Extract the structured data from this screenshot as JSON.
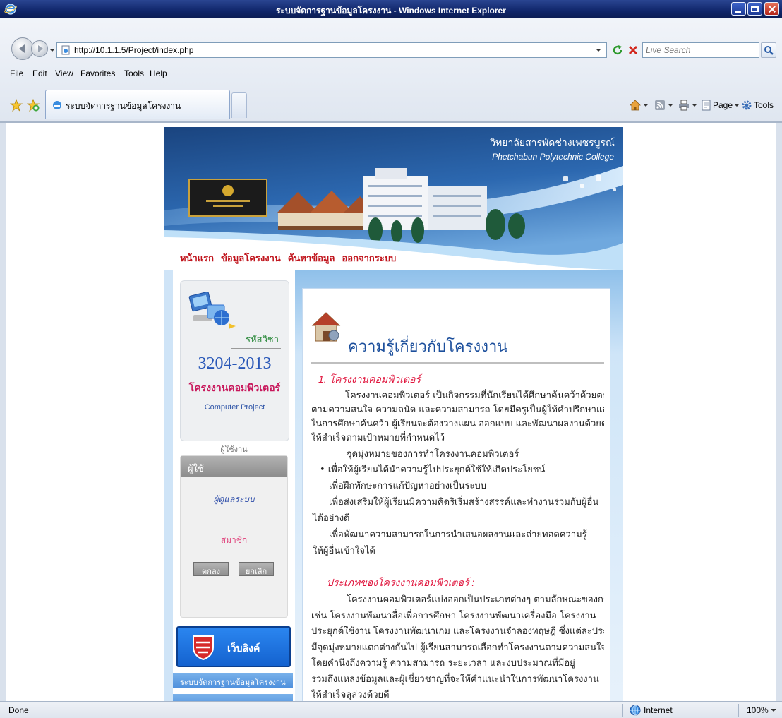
{
  "theme": {
    "title_bar": "#10266a",
    "site_blue": "#1c4f9c",
    "site_red": "#c0141c",
    "accent": "#1a6fe0"
  },
  "browser": {
    "title": "ระบบจัดการฐานข้อมูลโครงงาน - Windows Internet Explorer",
    "address": "http://10.1.1.5/Project/index.php",
    "search_placeholder": "Live Search",
    "menu": [
      "File",
      "Edit",
      "View",
      "Favorites",
      "Tools",
      "Help"
    ],
    "tab_title": "ระบบจัดการฐานข้อมูลโครงงาน",
    "command_bar": {
      "page": "Page",
      "tools": "Tools"
    },
    "status": {
      "text": "Done",
      "zone": "Internet",
      "zoom": "100%"
    },
    "icons": [
      "ie-icon",
      "back-icon",
      "forward-icon",
      "refresh-icon",
      "stop-icon",
      "search-icon",
      "favorites-star-icon",
      "add-favorites-icon",
      "home-icon",
      "feeds-icon",
      "print-icon",
      "page-icon",
      "tools-gear-icon",
      "globe-icon"
    ]
  },
  "site": {
    "banner": {
      "title_th": "วิทยาลัยสารพัดช่างเพชรบูรณ์",
      "title_en": "Phetchabun Polytechnic College"
    },
    "nav": [
      "หน้าแรก",
      "ข้อมูลโครงงาน",
      "ค้นหาข้อมูล",
      "ออกจากระบบ"
    ],
    "course_box": {
      "label": "รหัสวิชา",
      "code": "3204-2013",
      "name_th": "โครงงานคอมพิวเตอร์",
      "name_en": "Computer Project"
    },
    "user_caption": "ผู้ใช้งาน",
    "login": {
      "header": "ผู้ใช้",
      "admin_link": "ผู้ดูแลระบบ",
      "member_link": "สมาชิก",
      "ok": "ตกลง",
      "cancel": "ยกเลิก"
    },
    "links_box": {
      "label": "เว็บลิงค์"
    },
    "sidebar_links": [
      "ระบบจัดการฐานข้อมูลโครงงาน"
    ]
  },
  "main": {
    "heading": "ความรู้เกี่ยวกับโครงงาน",
    "section1": {
      "title": "1. โครงงานคอมพิวเตอร์",
      "para": [
        "โครงงานคอมพิวเตอร์ เป็นกิจกรรมที่นักเรียนได้ศึกษาค้นคว้าด้วยตนเอง",
        "ตามความสนใจ ความถนัด และความสามารถ โดยมีครูเป็นผู้ให้คำปรึกษาและแนะนำ",
        "ในการศึกษาค้นคว้า ผู้เรียนจะต้องวางแผน ออกแบบ และพัฒนาผลงานด้วยตนเอง",
        "ให้สำเร็จตามเป้าหมายที่กำหนดไว้"
      ],
      "aim_title": "จุดมุ่งหมายของการทำโครงงานคอมพิวเตอร์",
      "aims": [
        "• เพื่อให้ผู้เรียนได้นำความรู้ไปประยุกต์ใช้ให้เกิดประโยชน์",
        "เพื่อฝึกทักษะการแก้ปัญหาอย่างเป็นระบบ",
        "เพื่อส่งเสริมให้ผู้เรียนมีความคิดริเริ่มสร้างสรรค์และทำงานร่วมกับผู้อื่น",
        "ได้อย่างดี",
        "เพื่อพัฒนาความสามารถในการนำเสนอผลงานและถ่ายทอดความรู้",
        "ให้ผู้อื่นเข้าใจได้"
      ]
    },
    "section2": {
      "title": "ประเภทของโครงงานคอมพิวเตอร์ :",
      "para": [
        "โครงงานคอมพิวเตอร์แบ่งออกเป็นประเภทต่างๆ ตามลักษณะของการใช้งาน",
        "เช่น โครงงานพัฒนาสื่อเพื่อการศึกษา โครงงานพัฒนาเครื่องมือ โครงงาน",
        "ประยุกต์ใช้งาน โครงงานพัฒนาเกม และโครงงานจำลองทฤษฎี ซึ่งแต่ละประเภท",
        "มีจุดมุ่งหมายแตกต่างกันไป ผู้เรียนสามารถเลือกทำโครงงานตามความสนใจ",
        "โดยคำนึงถึงความรู้ ความสามารถ ระยะเวลา และงบประมาณที่มีอยู่",
        "รวมถึงแหล่งข้อมูลและผู้เชี่ยวชาญที่จะให้คำแนะนำในการพัฒนาโครงงาน",
        "ให้สำเร็จลุล่วงด้วยดี"
      ]
    }
  }
}
